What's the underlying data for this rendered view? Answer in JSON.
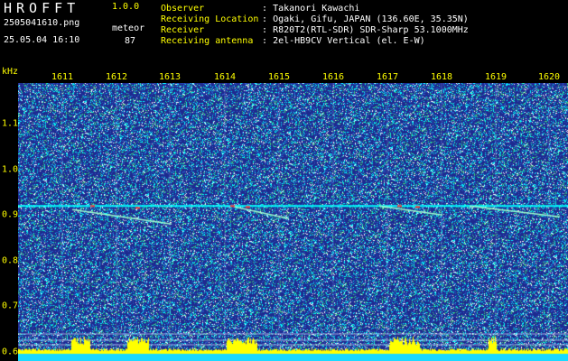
{
  "header": {
    "app_title": "HROFFT",
    "app_version": "1.0.0",
    "filename": "2505041610.png",
    "datetime": "25.05.04 16:10",
    "mode_label": "meteor",
    "meteor_count": "87"
  },
  "info": [
    {
      "key": "Observer",
      "sep": ":",
      "value": "Takanori Kawachi"
    },
    {
      "key": "Receiving Location",
      "sep": ":",
      "value": "Ogaki, Gifu, JAPAN (136.60E, 35.35N)"
    },
    {
      "key": "Receiver",
      "sep": ":",
      "value": "R820T2(RTL-SDR) SDR-Sharp 53.1000MHz"
    },
    {
      "key": "Receiving antenna",
      "sep": ":",
      "value": "2el-HB9CV Vertical (el. E-W)"
    }
  ],
  "spectrogram": {
    "unit_label": "kHz",
    "time_labels": [
      "1611",
      "1612",
      "1613",
      "1614",
      "1615",
      "1616",
      "1617",
      "1618",
      "1619",
      "1620"
    ],
    "freq_labels": [
      "1.1",
      "1.0",
      "0.9",
      "0.8",
      "0.7",
      "0.6"
    ],
    "freq_values": [
      1.1,
      1.0,
      0.9,
      0.8,
      0.7,
      0.6
    ],
    "freq_range": [
      0.58,
      1.19
    ],
    "carrier_freq": 0.92,
    "colors": {
      "background": "#1e2a8f",
      "noise_cyan": "#00ffff",
      "noise_white": "#ffffff",
      "signal": "#ff3333",
      "baseline": "#ffff00",
      "label": "#ffff00"
    }
  }
}
